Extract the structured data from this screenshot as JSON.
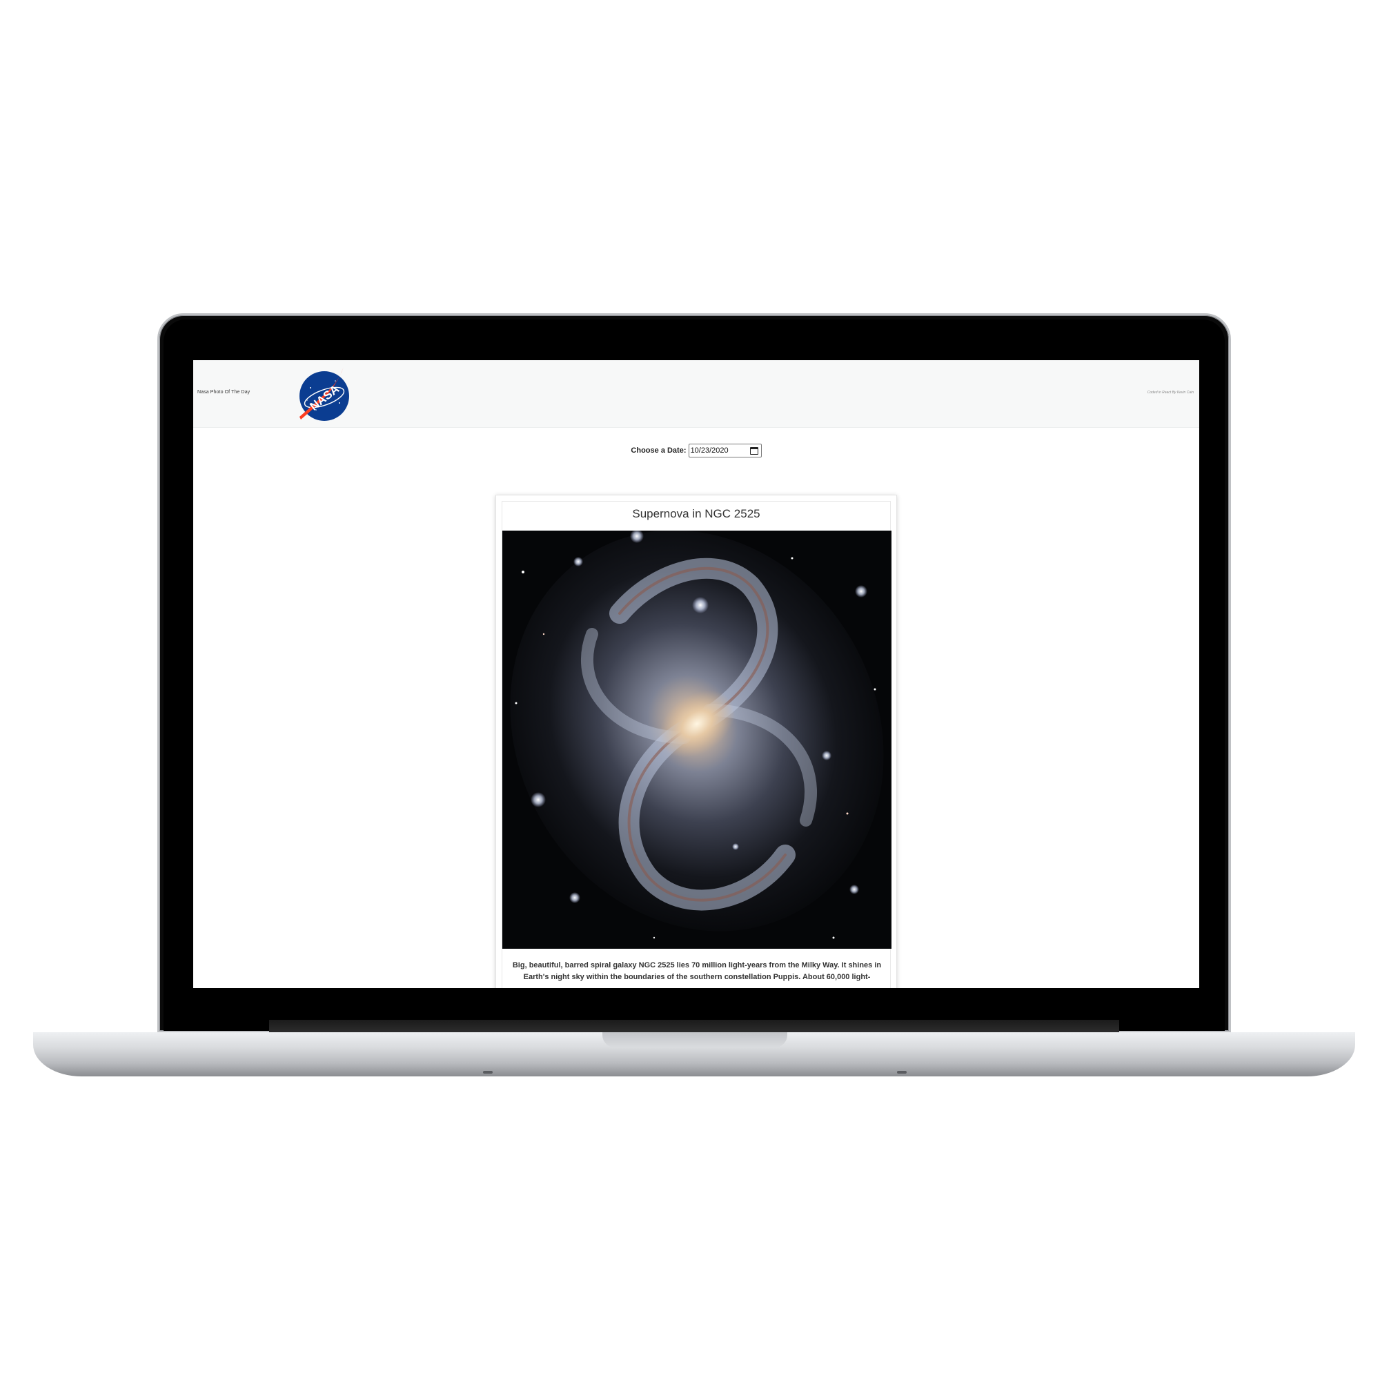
{
  "header": {
    "brand": "Nasa Photo Of The Day",
    "credit": "Coded in React By Kevin Cain",
    "logo_text": "NASA"
  },
  "date_picker": {
    "label": "Choose a Date:",
    "value": "10/23/2020"
  },
  "apod": {
    "title": "Supernova in NGC 2525",
    "explanation": "Big, beautiful, barred spiral galaxy NGC 2525 lies 70 million light-years from the Milky Way. It shines in Earth's night sky within the boundaries of the southern constellation Puppis. About 60,000 light-"
  },
  "colors": {
    "nasa_blue": "#0b3d91",
    "nasa_red": "#fc3d21",
    "navbar_bg": "#f7f8f8"
  }
}
